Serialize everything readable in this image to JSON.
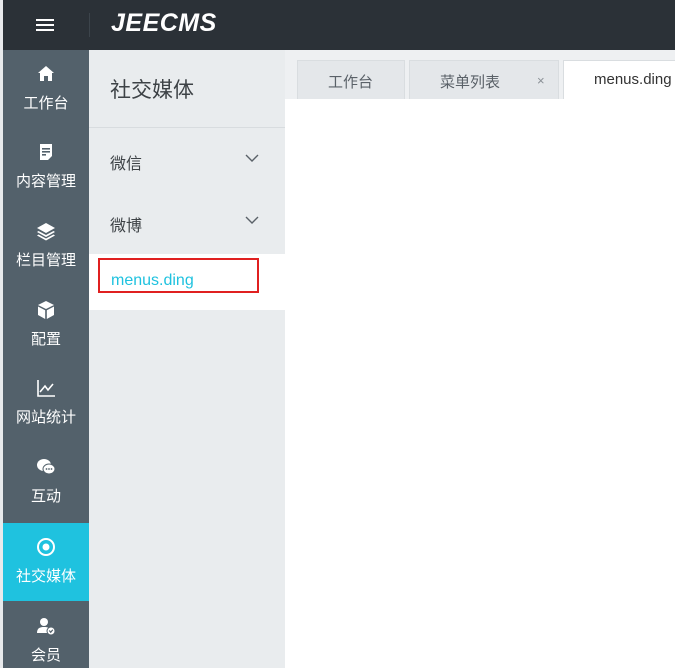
{
  "header": {
    "logo": "JEECMS",
    "menu_icon": "hamburger-menu-icon"
  },
  "leftnav": {
    "items": [
      {
        "label": "工作台",
        "icon": "home-icon"
      },
      {
        "label": "内容管理",
        "icon": "document-icon"
      },
      {
        "label": "栏目管理",
        "icon": "layers-icon"
      },
      {
        "label": "配置",
        "icon": "box-icon"
      },
      {
        "label": "网站统计",
        "icon": "line-chart-icon"
      },
      {
        "label": "互动",
        "icon": "chat-bubbles-icon"
      },
      {
        "label": "社交媒体",
        "icon": "target-icon",
        "active": true
      },
      {
        "label": "会员",
        "icon": "member-icon"
      }
    ]
  },
  "subnav": {
    "title": "社交媒体",
    "items": [
      {
        "label": "微信",
        "expandable": true
      },
      {
        "label": "微博",
        "expandable": true
      }
    ],
    "leaf": {
      "label": "menus.ding",
      "selected": true
    }
  },
  "tabs": [
    {
      "label": "工作台",
      "closable": false
    },
    {
      "label": "菜单列表",
      "closable": true,
      "close": "×"
    },
    {
      "label": "menus.ding",
      "closable": false,
      "active": true
    }
  ],
  "colors": {
    "topbar": "#2b3137",
    "leftnav": "#53616b",
    "accent": "#1fc2df",
    "subnav": "#e9ecee",
    "highlight": "#e02020"
  }
}
